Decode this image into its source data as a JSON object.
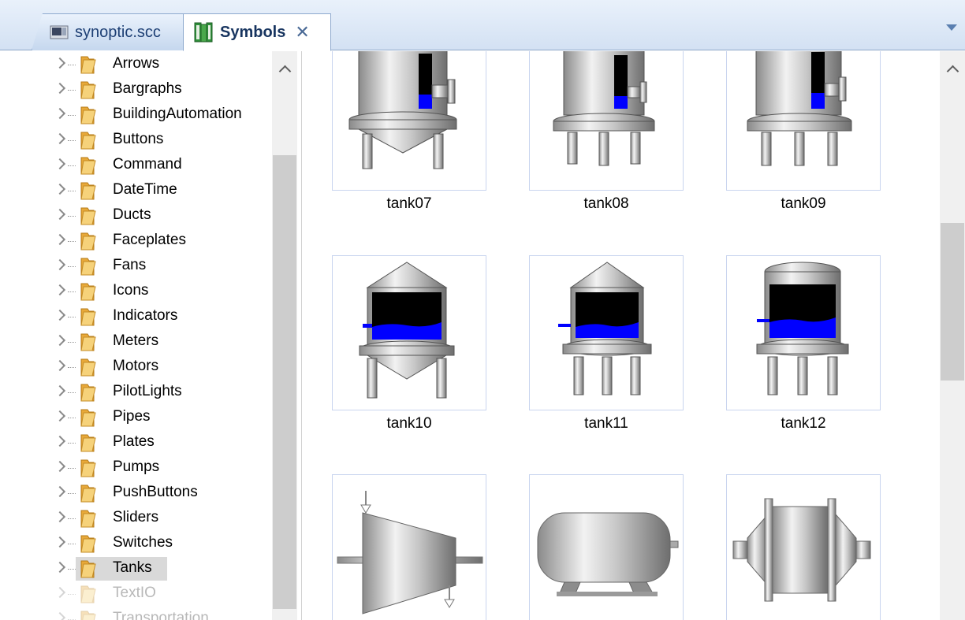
{
  "tabs": [
    {
      "label": "synoptic.scc",
      "active": false
    },
    {
      "label": "Symbols",
      "active": true
    }
  ],
  "tree": {
    "items": [
      {
        "label": "Arrows"
      },
      {
        "label": "Bargraphs"
      },
      {
        "label": "BuildingAutomation"
      },
      {
        "label": "Buttons"
      },
      {
        "label": "Command"
      },
      {
        "label": "DateTime"
      },
      {
        "label": "Ducts"
      },
      {
        "label": "Faceplates"
      },
      {
        "label": "Fans"
      },
      {
        "label": "Icons"
      },
      {
        "label": "Indicators"
      },
      {
        "label": "Meters"
      },
      {
        "label": "Motors"
      },
      {
        "label": "PilotLights"
      },
      {
        "label": "Pipes"
      },
      {
        "label": "Plates"
      },
      {
        "label": "Pumps"
      },
      {
        "label": "PushButtons"
      },
      {
        "label": "Sliders"
      },
      {
        "label": "Switches"
      },
      {
        "label": "Tanks"
      },
      {
        "label": "TextIO"
      },
      {
        "label": "Transportation"
      }
    ],
    "selected": "Tanks"
  },
  "symbols": [
    {
      "name": "tank07"
    },
    {
      "name": "tank08"
    },
    {
      "name": "tank09"
    },
    {
      "name": "tank10"
    },
    {
      "name": "tank11"
    },
    {
      "name": "tank12"
    },
    {
      "name": ""
    },
    {
      "name": ""
    },
    {
      "name": ""
    }
  ],
  "colors": {
    "accent_blue": "#0000ff",
    "tab_text": "#1d3f74",
    "card_border": "#c9d5ef",
    "selection": "#d9d9d9"
  },
  "icons": {
    "tab_file": "synoptic-file-icon",
    "tab_symbols": "symbols-library-icon",
    "close": "close-icon",
    "overflow": "chevron-down-icon",
    "folder": "folder-icon",
    "expander": "chevron-right-icon"
  }
}
